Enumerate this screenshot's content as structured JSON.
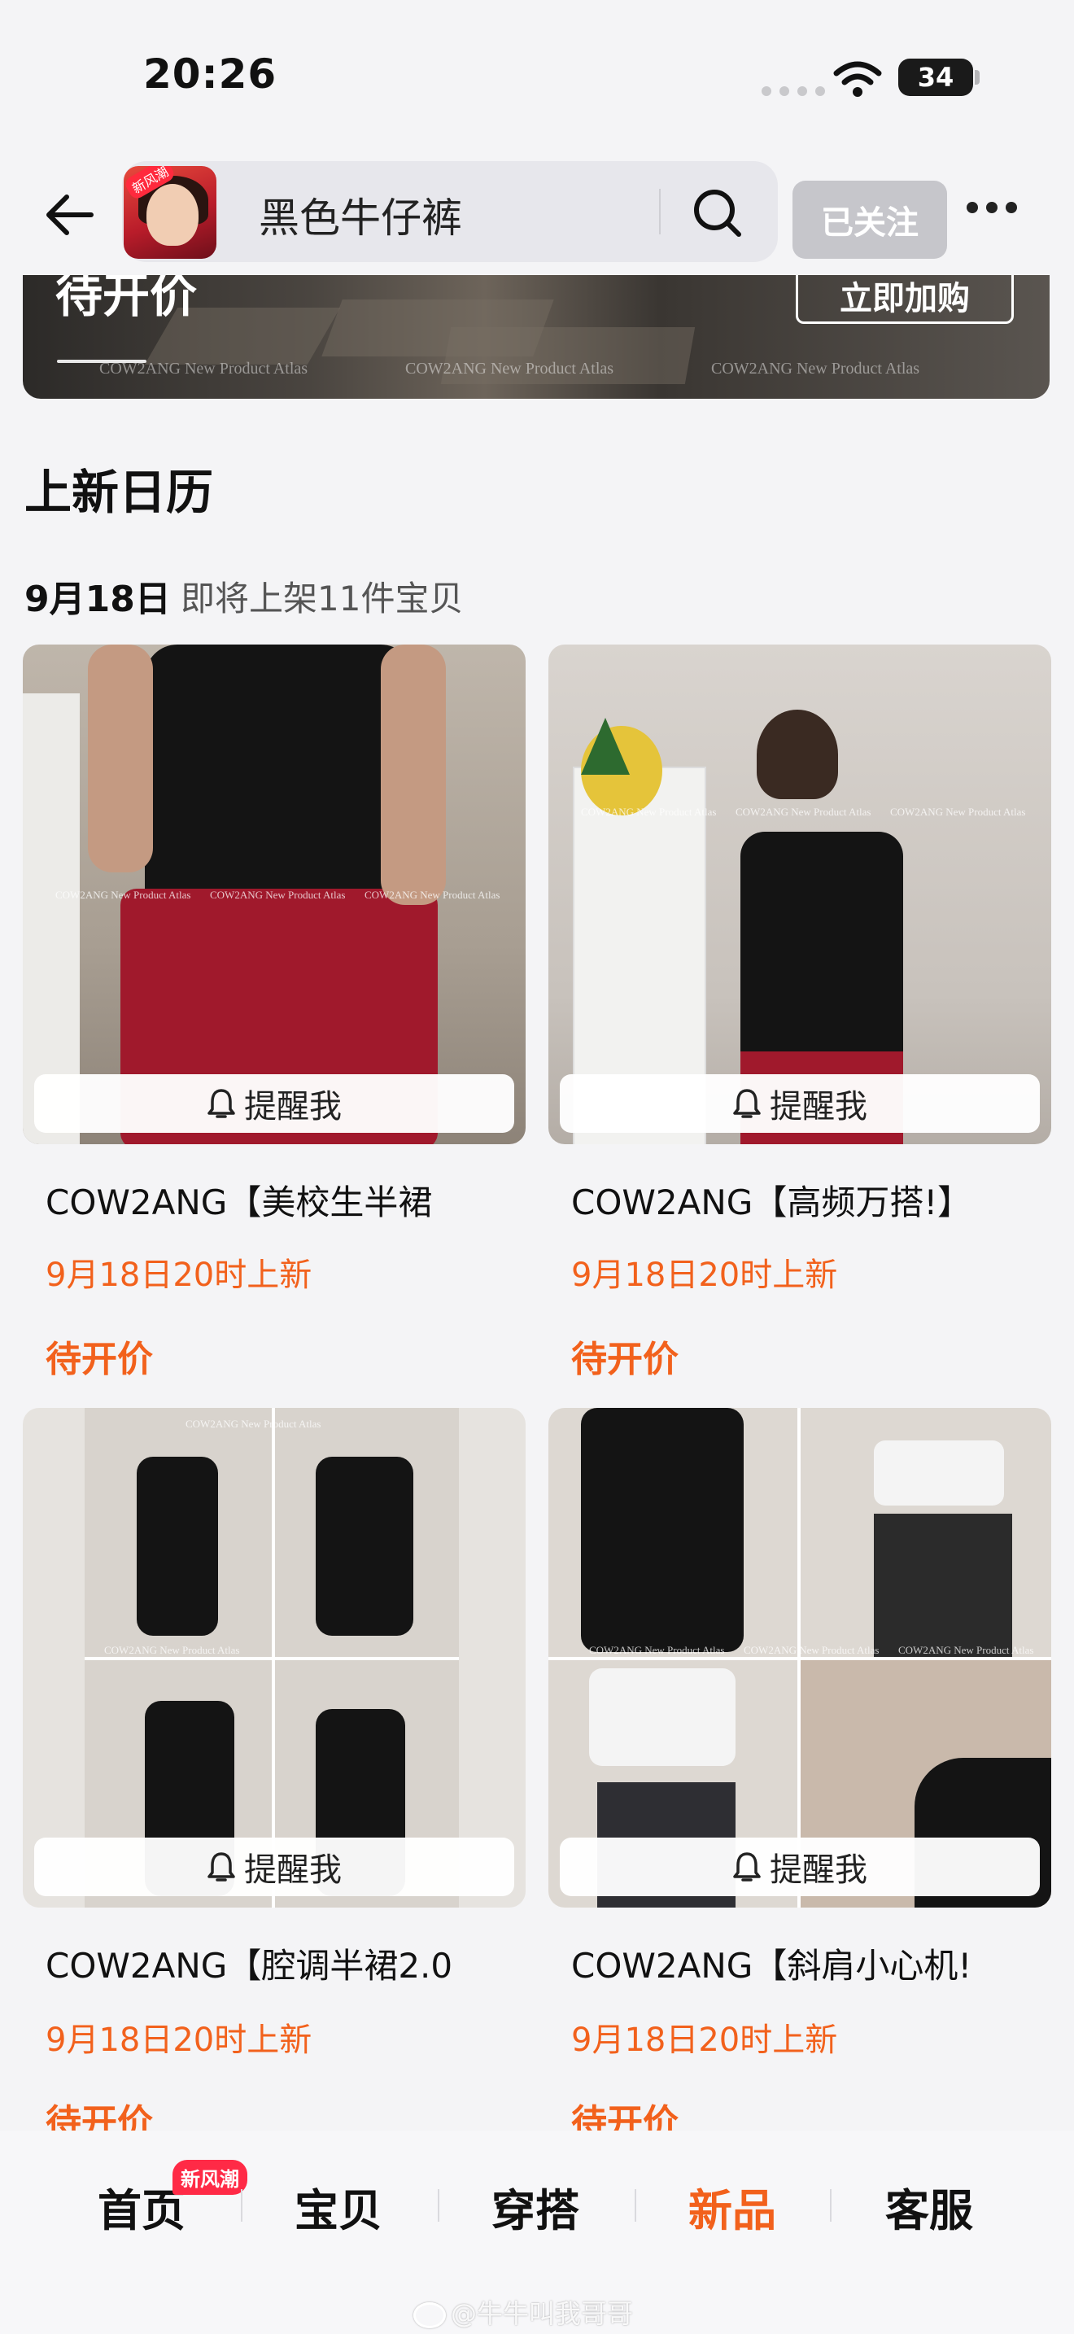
{
  "status_bar": {
    "time": "20:26",
    "battery": "34"
  },
  "header": {
    "avatar_badge": "新风潮",
    "search_text": "黑色牛仔裤",
    "follow_label": "已关注"
  },
  "banner": {
    "price_label": "待开价",
    "buy_button": "立即加购",
    "watermark": "COW2ANG New Product Atlas"
  },
  "section": {
    "title": "上新日历",
    "date": "9月18日",
    "date_sub": "即将上架11件宝贝"
  },
  "products": [
    {
      "title": "COW2ANG【美校生半裙",
      "time": "9月18日20时上新",
      "price": "待开价",
      "remind": "提醒我"
    },
    {
      "title": "COW2ANG【高频万搭!】",
      "time": "9月18日20时上新",
      "price": "待开价",
      "remind": "提醒我"
    },
    {
      "title": "COW2ANG【腔调半裙2.0",
      "time": "9月18日20时上新",
      "price": "待开价",
      "remind": "提醒我"
    },
    {
      "title": "COW2ANG【斜肩小心机!",
      "time": "9月18日20时上新",
      "price": "待开价",
      "remind": "提醒我"
    }
  ],
  "tabbar": {
    "tabs": [
      "首页",
      "宝贝",
      "穿搭",
      "新品",
      "客服"
    ],
    "active_tab": "新品",
    "home_badge": "新风潮"
  },
  "watermark": "@牛牛叫我哥哥",
  "colors": {
    "accent": "#f2611c",
    "badge": "#ff2a46",
    "follow_bg": "#c6c6cb"
  },
  "icons": [
    "back-arrow-icon",
    "search-icon",
    "more-icon",
    "bell-icon",
    "wifi-icon",
    "signal-icon",
    "battery-icon",
    "weibo-icon"
  ]
}
